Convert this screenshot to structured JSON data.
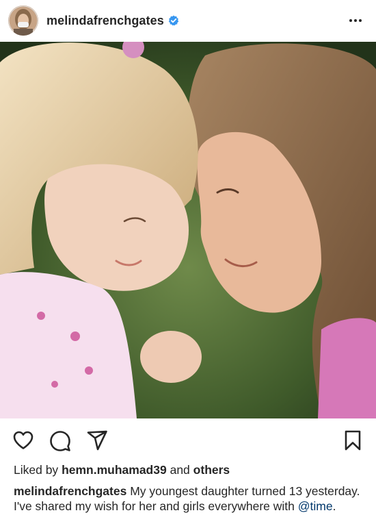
{
  "post": {
    "username": "melindafrenchgates",
    "verified": true,
    "avatar_icon": "profile-avatar",
    "more_icon": "more-dots-icon"
  },
  "actions": {
    "like_icon": "heart-icon",
    "comment_icon": "comment-icon",
    "share_icon": "share-icon",
    "save_icon": "bookmark-icon"
  },
  "likes": {
    "prefix": "Liked by",
    "user": "hemn.muhamad39",
    "joiner": "and",
    "others": "others"
  },
  "caption": {
    "username": "melindafrenchgates",
    "text": "My youngest daughter turned 13 yesterday. I've shared my wish for her and girls everywhere with",
    "mention": "@time",
    "end": "."
  },
  "colors": {
    "text": "#262626",
    "verified_badge": "#3897f0",
    "mention": "#00376b"
  }
}
